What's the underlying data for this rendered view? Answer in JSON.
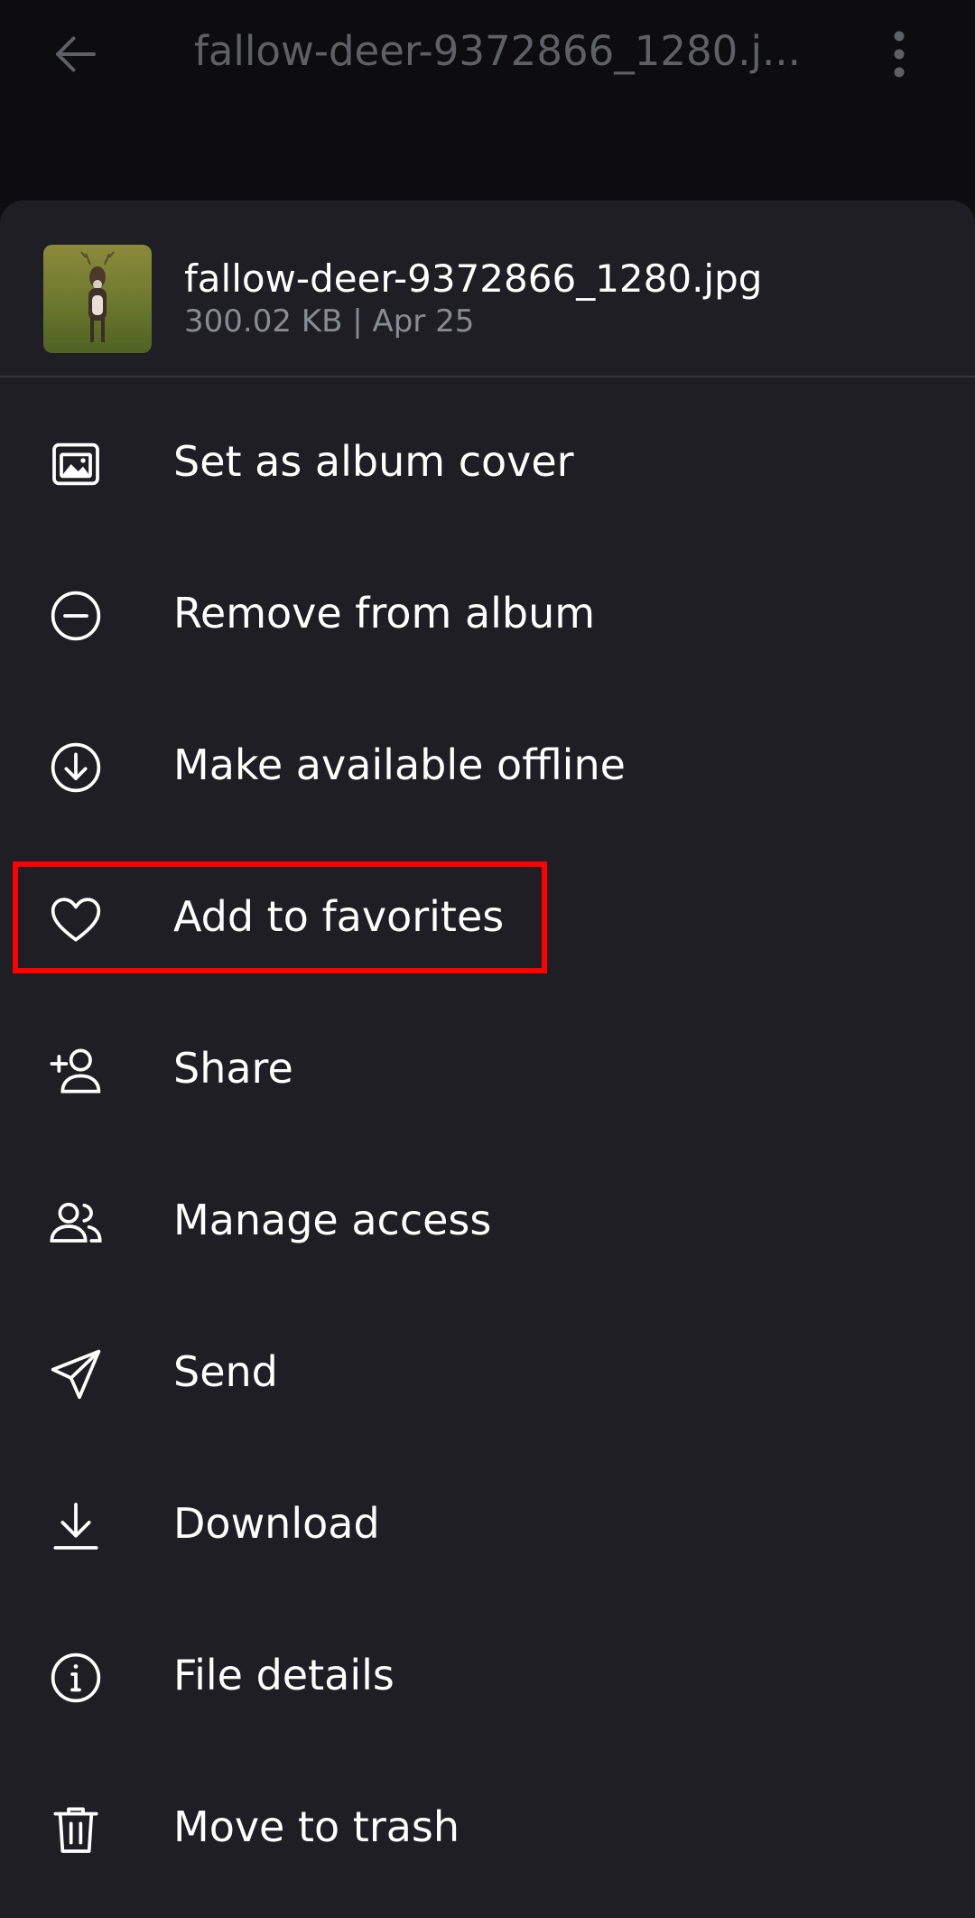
{
  "topbar": {
    "title": "fallow-deer-9372866_1280.j...",
    "back_icon": "arrow-left-icon",
    "more_icon": "more-vertical-icon"
  },
  "file": {
    "name": "fallow-deer-9372866_1280.jpg",
    "meta": "300.02 KB | Apr 25"
  },
  "menu": [
    {
      "label": "Set as album cover",
      "icon": "image-icon"
    },
    {
      "label": "Remove from album",
      "icon": "minus-circle-icon"
    },
    {
      "label": "Make available offline",
      "icon": "download-circle-icon"
    },
    {
      "label": "Add to favorites",
      "icon": "heart-icon"
    },
    {
      "label": "Share",
      "icon": "person-add-icon"
    },
    {
      "label": "Manage access",
      "icon": "people-icon"
    },
    {
      "label": "Send",
      "icon": "send-icon"
    },
    {
      "label": "Download",
      "icon": "download-icon"
    },
    {
      "label": "File details",
      "icon": "info-icon"
    },
    {
      "label": "Move to trash",
      "icon": "trash-icon"
    }
  ],
  "colors": {
    "background": "#0d0d11",
    "sheet": "#1e1e24",
    "highlight": "#ff0000",
    "meta_text": "#8a8a92"
  }
}
